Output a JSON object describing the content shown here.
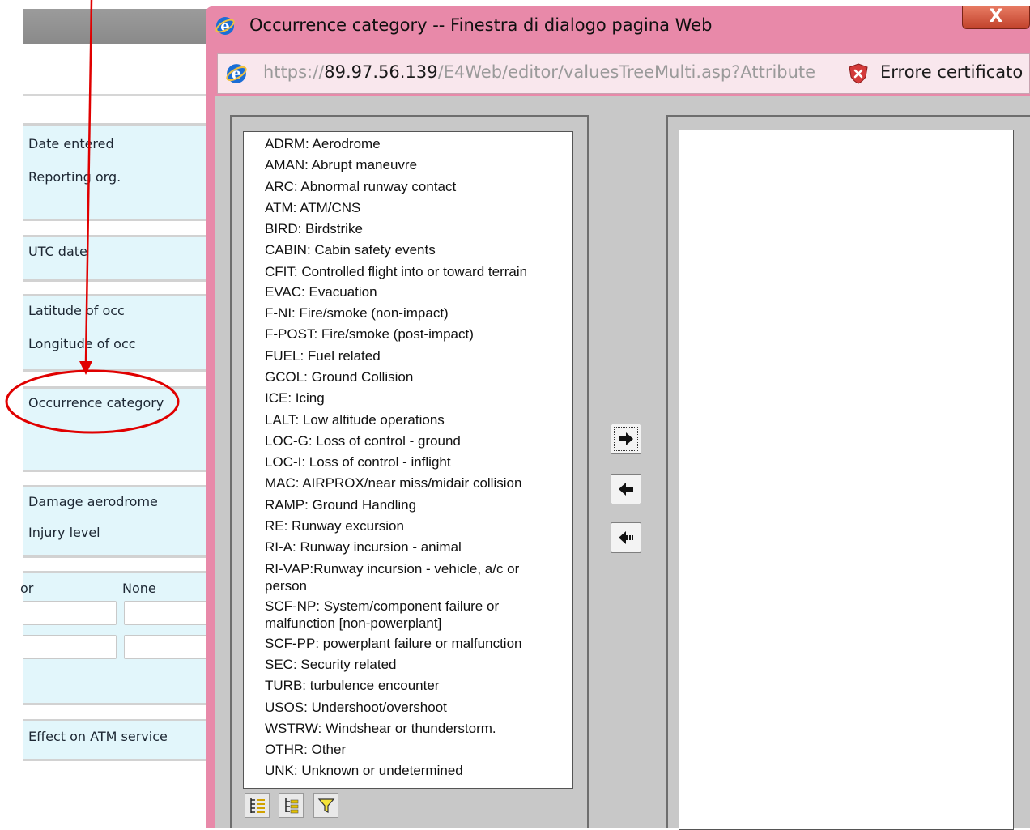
{
  "background_form": {
    "fields": {
      "date_entered": "Date entered",
      "reporting_org": "Reporting org.",
      "utc_date": "UTC date",
      "latitude": "Latitude of occ",
      "longitude": "Longitude of occ",
      "occurrence_category": "Occurrence category",
      "damage_aerodrome": "Damage aerodrome",
      "injury_level": "Injury level",
      "col_partial": "or",
      "col_none": "None",
      "effect_on_atm": "Effect on ATM service"
    }
  },
  "dialog": {
    "title": "Occurrence category -- Finestra di dialogo pagina Web",
    "close_label": "X",
    "address": {
      "url_prefix": "https://",
      "url_host": "89.97.56.139",
      "url_path": "/E4Web/editor/valuesTreeMulti.asp?Attribute",
      "cert_error": "Errore certificato"
    },
    "categories": [
      "ADRM: Aerodrome",
      "AMAN: Abrupt maneuvre",
      "ARC: Abnormal runway contact",
      "ATM: ATM/CNS",
      "BIRD: Birdstrike",
      "CABIN: Cabin safety events",
      "CFIT: Controlled flight into or toward terrain",
      "EVAC: Evacuation",
      "F-NI: Fire/smoke (non-impact)",
      "F-POST: Fire/smoke (post-impact)",
      "FUEL: Fuel related",
      "GCOL: Ground Collision",
      "ICE: Icing",
      "LALT: Low altitude operations",
      "LOC-G: Loss of control - ground",
      "LOC-I: Loss of control - inflight",
      "MAC: AIRPROX/near miss/midair collision",
      "RAMP: Ground Handling",
      "RE: Runway excursion",
      "RI-A: Runway incursion - animal",
      "RI-VAP:Runway incursion - vehicle, a/c or person",
      "SCF-NP: System/component failure or malfunction [non-powerplant]",
      "SCF-PP: powerplant failure or malfunction",
      "SEC: Security related",
      "TURB: turbulence encounter",
      "USOS: Undershoot/overshoot",
      "WSTRW: Windshear or thunderstorm.",
      "OTHR: Other",
      "UNK: Unknown or undetermined"
    ],
    "icons": {
      "add": "arrow-right-icon",
      "remove": "arrow-left-icon",
      "remove_all": "double-arrow-left-icon",
      "expand": "list-expand-icon",
      "tree": "tree-icon",
      "filter": "filter-icon"
    }
  },
  "colors": {
    "dialog_frame": "#e889a9",
    "annotation": "#e00000",
    "form_section": "#e2f6fb"
  }
}
